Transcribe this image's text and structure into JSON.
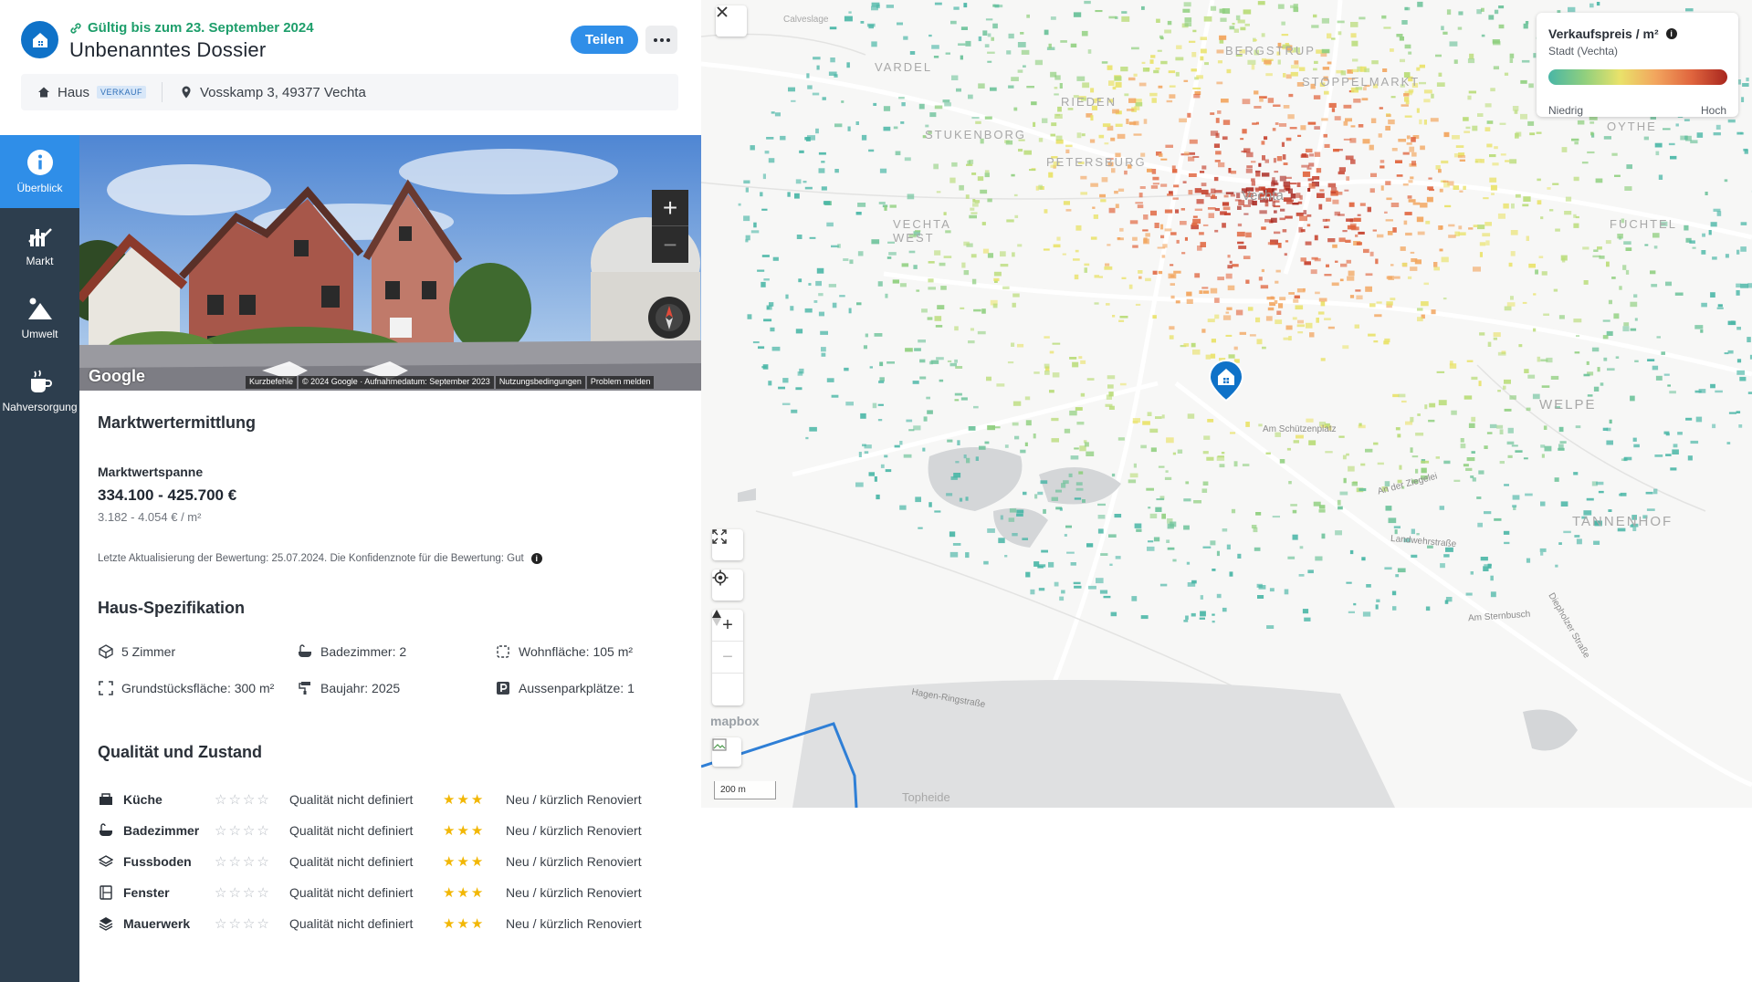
{
  "header": {
    "valid_until": "Gültig bis zum 23. September 2024",
    "title": "Unbenanntes Dossier",
    "share_label": "Teilen",
    "property_type": "Haus",
    "property_tag": "VERKAUF",
    "address": "Vosskamp 3, 49377 Vechta"
  },
  "sidenav": {
    "items": [
      {
        "label": "Überblick",
        "icon": "info-icon"
      },
      {
        "label": "Markt",
        "icon": "chart-icon"
      },
      {
        "label": "Umwelt",
        "icon": "landscape-icon"
      },
      {
        "label": "Nahversorgung",
        "icon": "cup-icon"
      }
    ]
  },
  "streetview": {
    "logo": "Google",
    "footer": [
      "Kurzbefehle",
      "© 2024 Google · Aufnahmedatum: September 2023",
      "Nutzungsbedingungen",
      "Problem melden"
    ]
  },
  "valuation": {
    "heading": "Marktwertermittlung",
    "range_label": "Marktwertspanne",
    "range_value": "334.100 - 425.700 €",
    "per_sqm": "3.182 - 4.054 € / m²",
    "updated": "Letzte Aktualisierung der Bewertung: 25.07.2024. Die Konfidenznote für die Bewertung: Gut"
  },
  "specs": {
    "heading": "Haus-Spezifikation",
    "items": [
      {
        "label": "5 Zimmer",
        "icon": "rooms-icon"
      },
      {
        "label": "Badezimmer: 2",
        "icon": "bathtub-icon"
      },
      {
        "label": "Wohnfläche: 105 m²",
        "icon": "area-icon"
      },
      {
        "label": "Grundstücksfläche: 300 m²",
        "icon": "expand-icon"
      },
      {
        "label": "Baujahr: 2025",
        "icon": "paint-roller-icon"
      },
      {
        "label": "Aussenparkplätze: 1",
        "icon": "parking-icon"
      }
    ]
  },
  "quality": {
    "heading": "Qualität und Zustand",
    "rows": [
      {
        "name": "Küche",
        "quality": "Qualität nicht definiert",
        "condition": "Neu / kürzlich Renoviert",
        "icon": "kitchen-icon"
      },
      {
        "name": "Badezimmer",
        "quality": "Qualität nicht definiert",
        "condition": "Neu / kürzlich Renoviert",
        "icon": "bathtub-icon"
      },
      {
        "name": "Fussboden",
        "quality": "Qualität nicht definiert",
        "condition": "Neu / kürzlich Renoviert",
        "icon": "floor-layers-icon"
      },
      {
        "name": "Fenster",
        "quality": "Qualität nicht definiert",
        "condition": "Neu / kürzlich Renoviert",
        "icon": "window-icon"
      },
      {
        "name": "Mauerwerk",
        "quality": "Qualität nicht definiert",
        "condition": "Neu / kürzlich Renoviert",
        "icon": "masonry-icon"
      }
    ],
    "quality_stars": 0,
    "condition_stars": 3,
    "max_stars": 4
  },
  "map": {
    "legend_title": "Verkaufspreis / m²",
    "legend_subtitle": "Stadt (Vechta)",
    "legend_low": "Niedrig",
    "legend_high": "Hoch",
    "scale_label": "200 m",
    "attribution": "mapbox",
    "places": [
      "Calveslage",
      "BERGSTRUP",
      "VARDEL",
      "STOPPELMARKT",
      "RIEDEN",
      "STUKENBORG",
      "PETERSBURG",
      "Vechta",
      "OYTHE",
      "FUCHTEL",
      "VECHTA WEST",
      "WELPE",
      "TANNENHOF",
      "Topheide"
    ],
    "streets": [
      "Am Schützenplatz",
      "Hagen-Ringstraße",
      "Landwehrstraße",
      "Am Sternbusch",
      "Diepholzer Straße",
      "An der Ziegelei"
    ]
  }
}
